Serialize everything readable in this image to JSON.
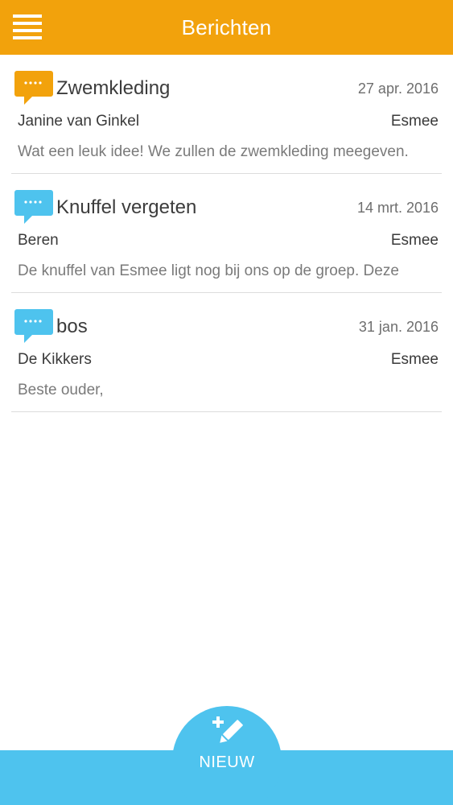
{
  "colors": {
    "header": "#f2a20c",
    "accent_blue": "#4ec3ee",
    "orange_bubble": "#f2a20c",
    "blue_bubble": "#4ec3ee"
  },
  "header": {
    "title": "Berichten",
    "menu_icon": "hamburger-menu-icon"
  },
  "messages": [
    {
      "subject": "Zwemkleding",
      "date": "27 apr. 2016",
      "sender": "Janine van Ginkel",
      "child": "Esmee",
      "preview": "Wat een leuk idee! We zullen de zwemkleding meegeven.",
      "bubble_color": "#f2a20c",
      "icon": "chat-bubble-icon"
    },
    {
      "subject": "Knuffel vergeten",
      "date": "14 mrt. 2016",
      "sender": "Beren",
      "child": "Esmee",
      "preview": "De knuffel van Esmee ligt nog bij ons op de groep. Deze",
      "bubble_color": "#4ec3ee",
      "icon": "chat-bubble-icon"
    },
    {
      "subject": "bos",
      "date": "31 jan. 2016",
      "sender": "De Kikkers",
      "child": "Esmee",
      "preview": "Beste ouder,",
      "bubble_color": "#4ec3ee",
      "icon": "chat-bubble-icon"
    }
  ],
  "new_button": {
    "label": "NIEUW",
    "icon": "compose-pencil-icon"
  }
}
